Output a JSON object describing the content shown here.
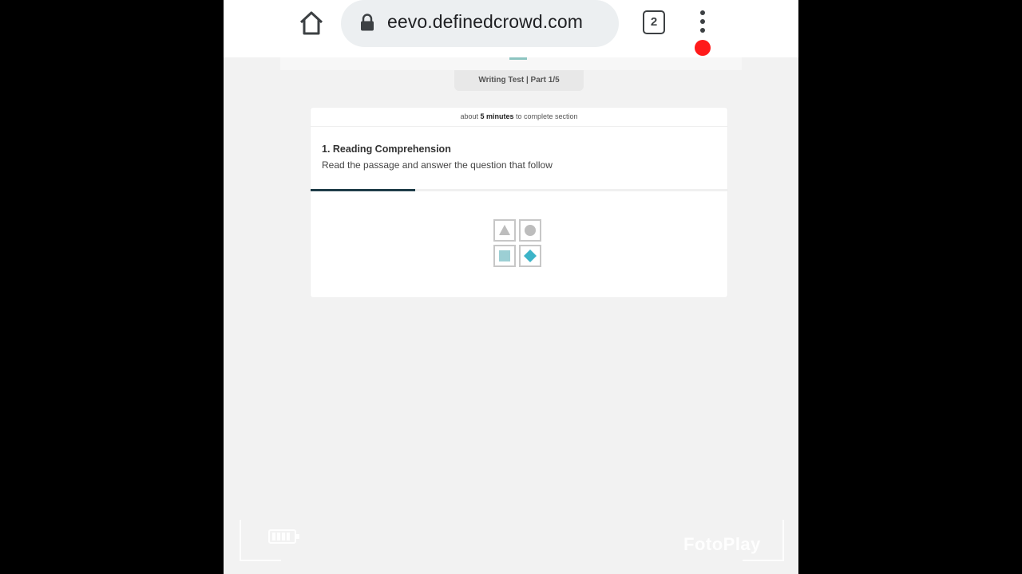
{
  "browser": {
    "url": "eevo.definedcrowd.com",
    "tab_count": "2"
  },
  "test": {
    "part_label": "Writing Test | Part 1/5",
    "time_prefix": "about ",
    "time_value": "5 minutes",
    "time_suffix": " to complete section",
    "section_title": "1. Reading Comprehension",
    "section_instruction": "Read the passage and answer the question that follow",
    "progress_fraction": 0.25
  },
  "overlay": {
    "watermark": "FotoPlay"
  },
  "colors": {
    "progress": "#1f3c48",
    "accent_teal": "#3cb4c8",
    "record": "#ff1a1a"
  },
  "icons": [
    "home-icon",
    "lock-icon",
    "tabs-counter-icon",
    "more-vert-icon",
    "triangle-icon",
    "circle-icon",
    "square-icon",
    "diamond-icon",
    "battery-icon"
  ]
}
